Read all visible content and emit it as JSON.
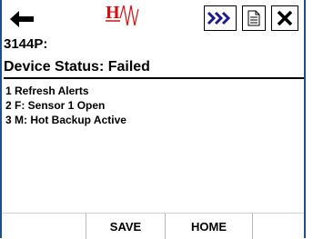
{
  "toolbar": {
    "back_icon": "left-arrow-icon",
    "logo_text": "H",
    "next_icon": "triple-chevron-right-icon",
    "document_icon": "document-icon",
    "close_icon": "close-x-icon",
    "accent_color": "#1b1b8f",
    "logo_color": "#d01010"
  },
  "device": {
    "id": "3144P:",
    "status": "Device Status: Failed"
  },
  "alerts": [
    "1 Refresh Alerts",
    "2 F: Sensor 1 Open",
    "3 M: Hot Backup Active"
  ],
  "footer": {
    "save_label": "SAVE",
    "home_label": "HOME"
  }
}
